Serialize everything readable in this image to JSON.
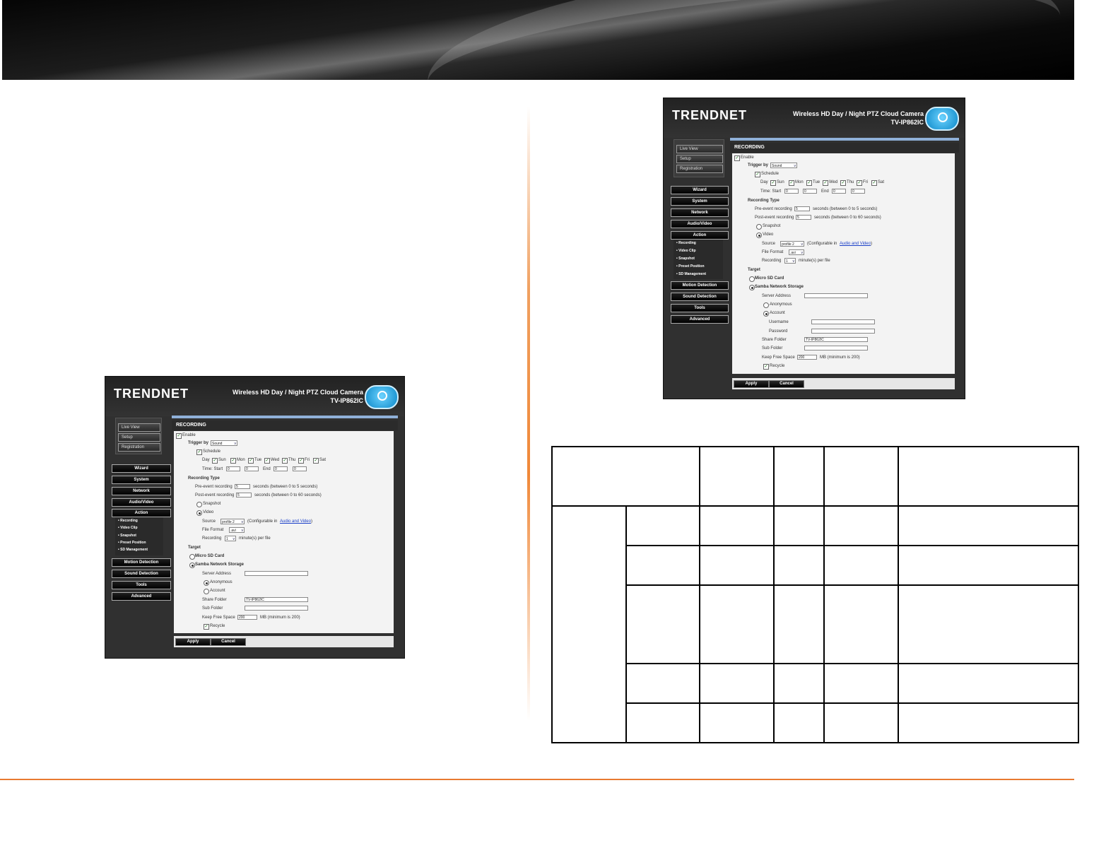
{
  "brand": "TRENDNET",
  "product_line1": "Wireless HD Day / Night PTZ Cloud Camera",
  "product_line2": "TV-IP862IC",
  "sidebar": {
    "live_view": "Live View",
    "setup": "Setup",
    "registration": "Registration",
    "nav": [
      "Wizard",
      "System",
      "Network",
      "Audio/Video",
      "Action"
    ],
    "action_sub": [
      "• Recording",
      "• Video Clip",
      "• Snapshot",
      "• Preset Position",
      "• SD Management"
    ],
    "nav_bottom": [
      "Motion Detection",
      "Sound Detection",
      "Tools",
      "Advanced"
    ]
  },
  "form": {
    "section_title": "RECORDING",
    "enable": "Enable",
    "trigger_by": "Trigger by",
    "trigger_value": "Sound",
    "schedule": "Schedule",
    "day": "Day",
    "days": [
      "Sun",
      "Mon",
      "Tue",
      "Wed",
      "Thu",
      "Fri",
      "Sat"
    ],
    "time_start": "Time: Start",
    "end": "End",
    "zero": "0",
    "time_end_right": "0",
    "recording_type": "Recording Type",
    "pre_event": "Pre-event recording",
    "pre_value": "5",
    "pre_hint": "seconds (between 0 to 5 seconds)",
    "post_event": "Post-event recording",
    "post_value": "5",
    "post_hint": "seconds (between 0 to 60 seconds)",
    "snapshot": "Snapshot",
    "video": "Video",
    "source": "Source",
    "source_value": "profile 2",
    "configurable": "(Configurable in",
    "audio_video_link": "Audio and Video",
    "close_paren": ")",
    "file_format": "File Format",
    "file_format_value": ".avi",
    "recording": "Recording",
    "recording_value": "1",
    "per_file": "minute(s) per file",
    "target": "Target",
    "micro_sd": "Micro SD Card",
    "samba": "Samba Network Storage",
    "server_address": "Server Address",
    "anonymous": "Anonymous",
    "account": "Account",
    "username": "Username",
    "password": "Password",
    "share_folder": "Share Folder",
    "share_folder_value": "TV-IP862IC",
    "sub_folder": "Sub Folder",
    "keep_free_space": "Keep Free Space",
    "keep_free_value": "200",
    "mb_hint": "MB (minimum is 200)",
    "recycle": "Recycle",
    "apply": "Apply",
    "cancel": "Cancel"
  },
  "colors": {
    "accent_orange": "#e87a30",
    "link_blue": "#1a3fc8"
  }
}
